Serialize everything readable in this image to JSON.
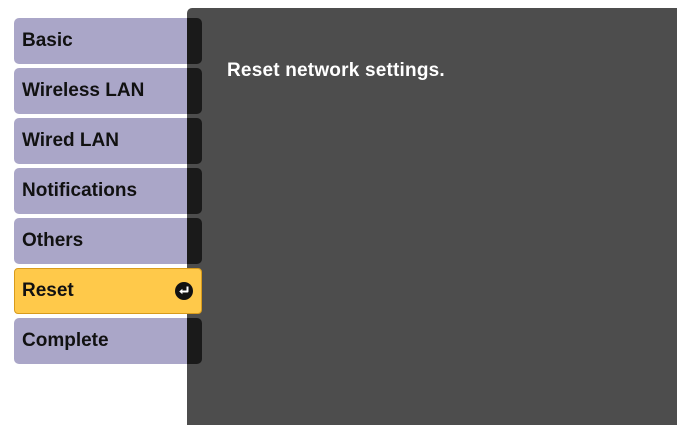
{
  "menu": {
    "items": [
      {
        "label": "Basic"
      },
      {
        "label": "Wireless LAN"
      },
      {
        "label": "Wired LAN"
      },
      {
        "label": "Notifications"
      },
      {
        "label": "Others"
      },
      {
        "label": "Reset",
        "selected": true,
        "icon": "enter-icon"
      },
      {
        "label": "Complete"
      }
    ]
  },
  "panel": {
    "message": "Reset network settings."
  },
  "colors": {
    "menu_item_bg": "#aaa6c8",
    "menu_item_selected_bg": "#ffc94a",
    "panel_bg": "#4d4d4d",
    "tab_dark": "#1a1a1a"
  }
}
